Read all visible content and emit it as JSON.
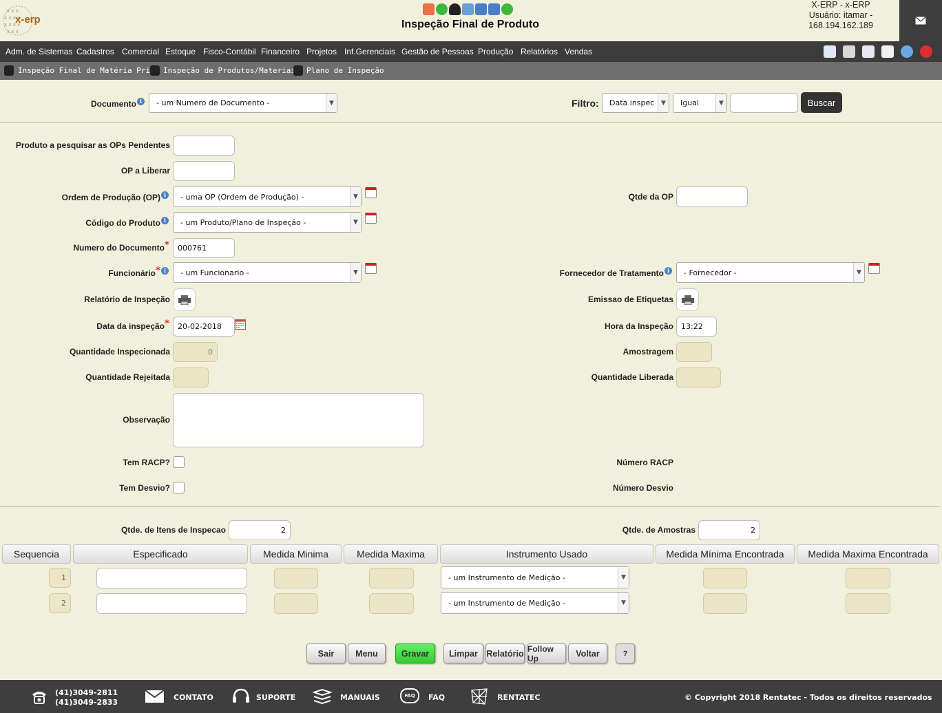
{
  "header": {
    "logo_text": "x-erp",
    "title": "Inspeção Final de Produto",
    "user_lines": [
      "X-ERP - x-ERP",
      "Usuário: itamar -",
      "168.194.162.189"
    ]
  },
  "menu": [
    "Adm. de Sistemas",
    "Cadastros",
    "Comercial",
    "Estoque",
    "Fisco-Contábil",
    "Financeiro",
    "Projetos",
    "Inf.Gerenciais",
    "Gestão de Pessoas",
    "Produção",
    "Relatórios",
    "Vendas"
  ],
  "submenu": [
    "Inspeção Final de Matéria Prima",
    "Inspeção de Produtos/Materiais",
    "Plano de Inspeção"
  ],
  "search": {
    "documento_label": "Documento",
    "documento_value": "- um Numero de Documento -",
    "filtro_label": "Filtro:",
    "filtro_field": "Data inspeca",
    "filtro_op": "Igual",
    "filtro_value": "",
    "buscar_label": "Buscar"
  },
  "form": {
    "produto_pesq_label": "Produto a pesquisar as OPs Pendentes",
    "op_liberar_label": "OP a Liberar",
    "ordem_label": "Ordem de Produção (OP)",
    "ordem_value": "- uma OP (Ordem de Produção) -",
    "qtde_op_label": "Qtde da OP",
    "codigo_label": "Código do Produto",
    "codigo_value": "- um Produto/Plano de Inspeção -",
    "numero_doc_label": "Numero do Documento",
    "numero_doc_value": "000761",
    "funcionario_label": "Funcionário",
    "funcionario_value": "- um Funcionario -",
    "fornecedor_label": "Fornecedor de Tratamento",
    "fornecedor_value": "- Fornecedor -",
    "relatorio_label": "Relatório de Inspeção",
    "etiquetas_label": "Emissao de Etiquetas",
    "data_label": "Data da inspeção",
    "data_value": "20-02-2018",
    "hora_label": "Hora da Inspeção",
    "hora_value": "13:22",
    "qtde_insp_label": "Quantidade Inspecionada",
    "qtde_insp_value": "0",
    "amostragem_label": "Amostragem",
    "qtde_rej_label": "Quantidade Rejeitada",
    "qtde_lib_label": "Quantidade Liberada",
    "observacao_label": "Observação",
    "racp_label": "Tem RACP?",
    "numero_racp_label": "Número RACP",
    "desvio_label": "Tem Desvio?",
    "numero_desvio_label": "Número Desvio",
    "qtde_itens_label": "Qtde. de Itens de Inspecao",
    "qtde_itens_value": "2",
    "qtde_amostras_label": "Qtde. de Amostras",
    "qtde_amostras_value": "2"
  },
  "table": {
    "headers": [
      "Sequencia",
      "Especificado",
      "Medida Minima",
      "Medida Maxima",
      "Instrumento Usado",
      "Medida Mínima Encontrada",
      "Medida Maxima Encontrada"
    ],
    "rows": [
      {
        "seq": "1",
        "instrumento": "- um Instrumento de Medição -"
      },
      {
        "seq": "2",
        "instrumento": "- um Instrumento de Medição -"
      }
    ]
  },
  "buttons": {
    "sair": "Sair",
    "menu": "Menu",
    "gravar": "Gravar",
    "limpar": "Limpar",
    "relatorio": "Relatório",
    "followup": "Follow Up",
    "voltar": "Voltar",
    "help": "?"
  },
  "footer": {
    "phone1": "(41)3049-2811",
    "phone2": "(41)3049-2833",
    "contato": "CONTATO",
    "suporte": "SUPORTE",
    "manuais": "MANUAIS",
    "faq": "FAQ",
    "faq_icon_text": "FAQ",
    "rentatec": "RENTATEC",
    "copyright": "© Copyright 2018 Rentatec - Todos os direitos reservados"
  },
  "colors": {
    "menubar": "#3b3b3b",
    "subbar": "#6e6e6e",
    "background": "#f1f0dc",
    "gravar": "#44dd44"
  }
}
